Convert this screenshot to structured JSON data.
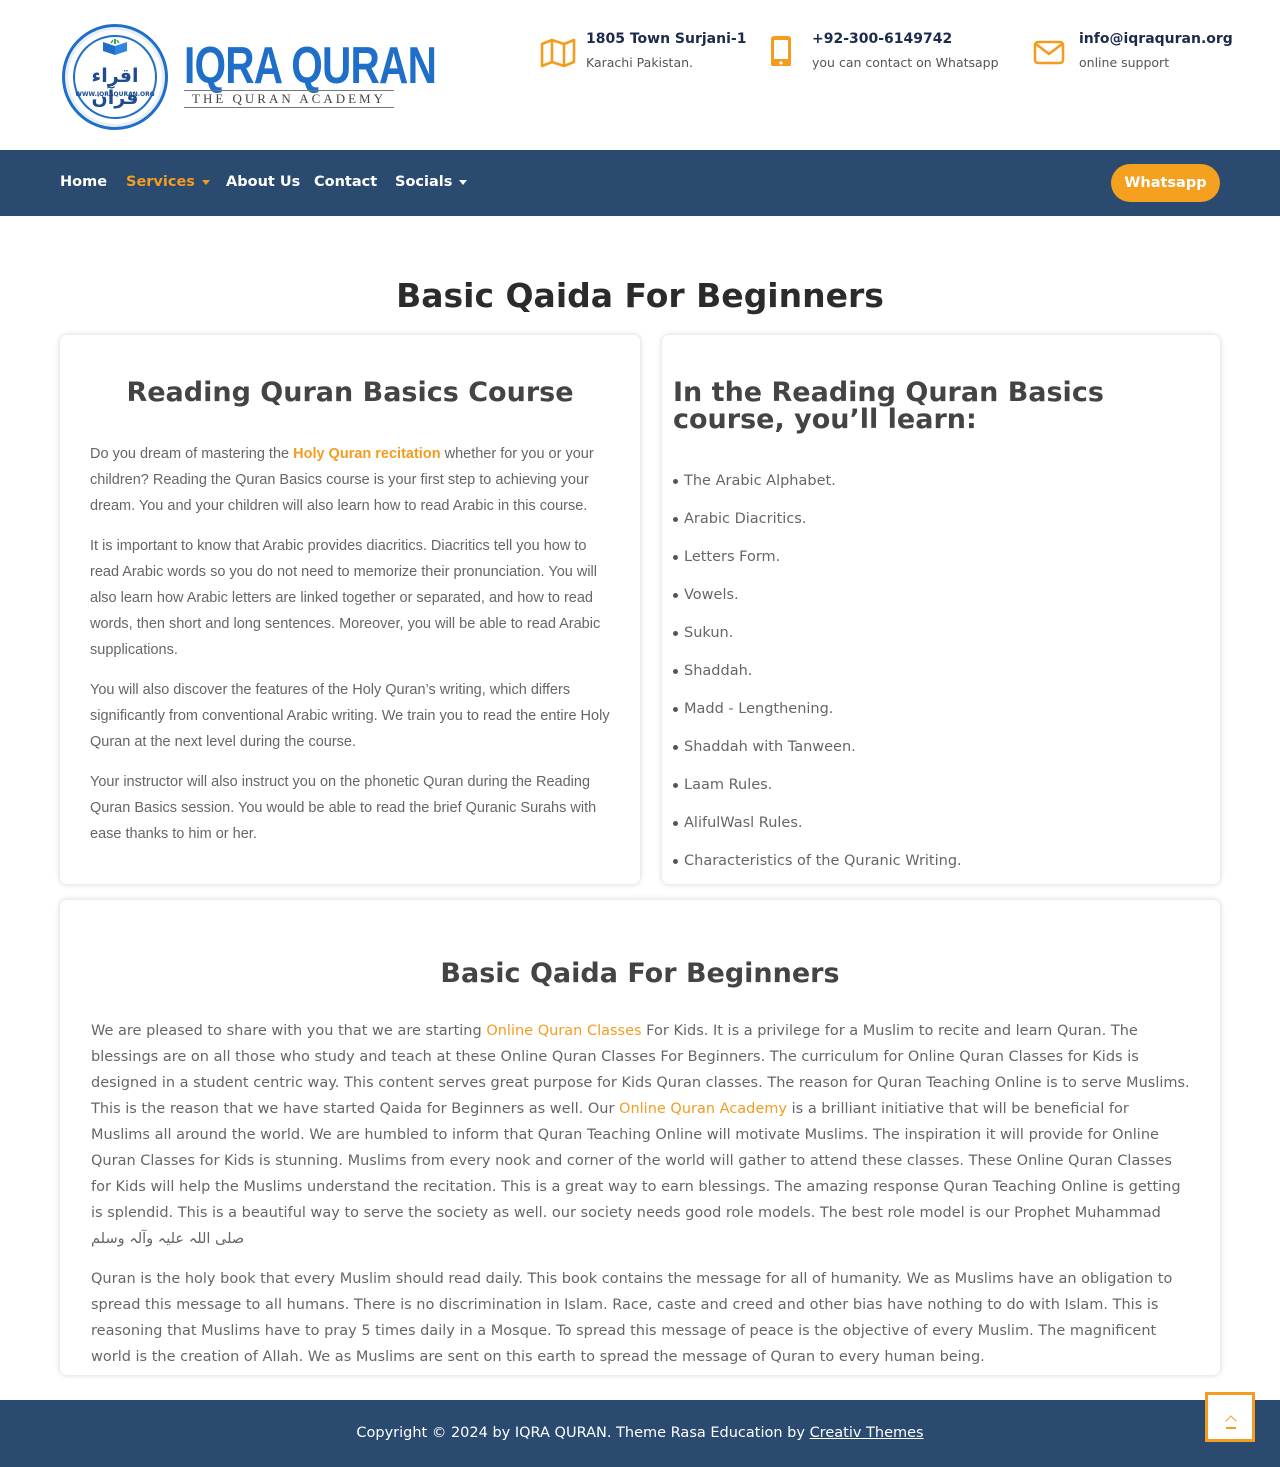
{
  "logo": {
    "title": "IQRA QURAN",
    "subtitle": "THE QURAN ACADEMY",
    "arabic": "اقراء قرآن",
    "url": "WWW.IQRAQURAN.ORG"
  },
  "contacts": [
    {
      "icon": "map-icon",
      "line1": "1805 Town Surjani-1",
      "line2": "Karachi Pakistan."
    },
    {
      "icon": "phone-icon",
      "line1": "+92-300-6149742",
      "line2": "you can contact on Whatsapp"
    },
    {
      "icon": "envelope-icon",
      "line1": "info@iqraquran.org",
      "line2": "online support"
    }
  ],
  "nav": {
    "items": [
      {
        "label": "Home",
        "dropdown": false,
        "active": false
      },
      {
        "label": "Services",
        "dropdown": true,
        "active": true
      },
      {
        "label": "About Us",
        "dropdown": false,
        "active": false
      },
      {
        "label": "Contact",
        "dropdown": false,
        "active": false
      },
      {
        "label": "Socials",
        "dropdown": true,
        "active": false
      }
    ],
    "cta": "Whatsapp"
  },
  "page_title": "Basic Qaida For Beginners",
  "course": {
    "heading": "Reading Quran Basics Course",
    "p1_before": "Do you dream of mastering the ",
    "p1_link": "Holy Quran recitation",
    "p1_after": " whether for you or your children? Reading the Quran Basics course is your first step to achieving your dream. You and your children will also learn how to read Arabic in this course.",
    "p2": "It is important to know that Arabic provides diacritics. Diacritics tell you how to read Arabic words so you do not need to memorize their pronunciation. You will also learn how Arabic letters are linked together or separated, and how to read words, then short and long sentences. Moreover, you will be able to read Arabic supplications.",
    "p3": "You will also discover the features of the Holy Quran’s writing, which differs significantly from conventional Arabic writing. We train you to read the entire Holy Quran at the next level during the course.",
    "p4": "Your instructor will also instruct you on the phonetic Quran during the Reading Quran Basics session. You would be able to read the brief Quranic Surahs with ease thanks to him or her."
  },
  "learn": {
    "heading": "In the Reading Quran Basics course, you’ll learn:",
    "items": [
      "The Arabic Alphabet.",
      "Arabic Diacritics.",
      "Letters Form.",
      "Vowels.",
      "Sukun.",
      "Shaddah.",
      "Madd - Lengthening.",
      "Shaddah with Tanween.",
      "Laam Rules.",
      "AlifulWasl Rules.",
      "Characteristics of the Quranic Writing."
    ]
  },
  "beginners": {
    "heading": "Basic Qaida For Beginners",
    "p1_a": "We are pleased to share with you that we are starting ",
    "p1_link1": "Online Quran Classes",
    "p1_b": " For Kids. It is a privilege for a Muslim to recite and learn Quran. The blessings are on all those who study and teach at these Online Quran Classes For Beginners. The curriculum for Online Quran Classes for Kids is designed in a student centric way. This content serves great purpose for Kids Quran classes. The reason for Quran Teaching Online is to serve Muslims. This is the reason that we have started Qaida for Beginners as well. Our ",
    "p1_link2": "Online Quran Academy",
    "p1_c": " is a brilliant initiative that will be beneficial for Muslims all around the world. We are humbled to inform that Quran Teaching Online will motivate Muslims. The inspiration it will provide for Online Quran Classes for Kids is stunning. Muslims from every nook and corner of the world will gather to attend these classes. These Online Quran Classes for Kids will help the Muslims understand the recitation. This is a great way to earn blessings. The amazing response Quran Teaching Online is getting is splendid. This is a beautiful way to serve the society as well. our society needs good role models. The best role model is our Prophet Muhammad صلی اللہ علیہ وآلہ وسلم",
    "p2": "Quran is the holy book that every Muslim should read daily. This book contains the message for all of humanity. We as Muslims have an obligation to spread this message to all humans. There is no discrimination in Islam. Race, caste and creed and other bias have nothing to do with Islam. This is reasoning that Muslims have to pray 5 times daily in a Mosque. To spread this message of peace is the objective of every Muslim. The magnificent world is the creation of Allah. We as Muslims are sent on this earth to spread the message of Quran to every human being."
  },
  "footer": {
    "text": "Copyright © 2024 by IQRA QURAN. Theme Rasa Education by ",
    "link": "Creativ Themes"
  },
  "colors": {
    "accent": "#f39c1f",
    "nav_bg": "#2a4a6f",
    "brand_blue": "#1f6fc9"
  }
}
